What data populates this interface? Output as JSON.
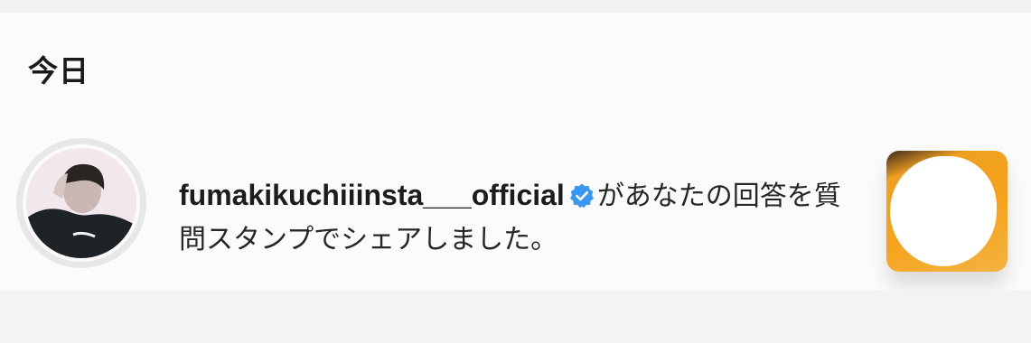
{
  "section": {
    "title": "今日"
  },
  "notification": {
    "username": "fumakikuchiiinsta___official",
    "message": "があなたの回答を質問スタンプでシェアしました。",
    "verified": true,
    "avatar_icon": "profile-photo",
    "thumbnail_icon": "story-thumbnail"
  },
  "colors": {
    "verified_badge": "#3897f0",
    "thumbnail_accent": "#f6a21a",
    "background": "#fbfbfb"
  }
}
